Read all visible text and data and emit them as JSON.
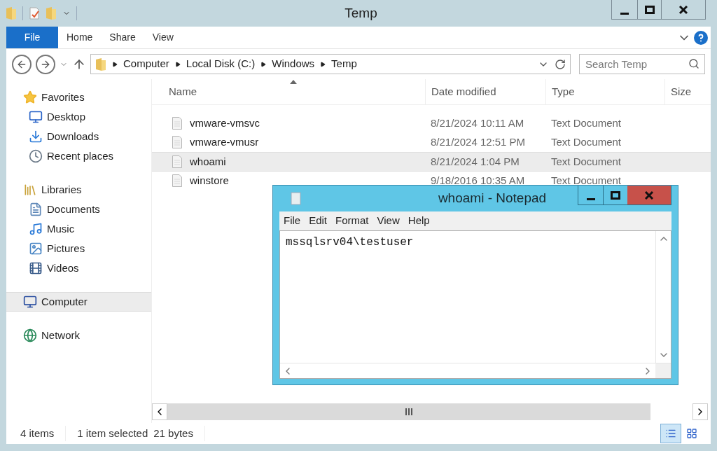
{
  "window": {
    "title": "Temp"
  },
  "ribbon": {
    "tabs": [
      {
        "label": "File",
        "selected": true
      },
      {
        "label": "Home",
        "selected": false
      },
      {
        "label": "Share",
        "selected": false
      },
      {
        "label": "View",
        "selected": false
      }
    ]
  },
  "address_bar": {
    "path": [
      "Computer",
      "Local Disk (C:)",
      "Windows",
      "Temp"
    ]
  },
  "search": {
    "placeholder": "Search Temp"
  },
  "navigation": {
    "groups": [
      {
        "label": "Favorites",
        "selected": false,
        "children": [
          {
            "label": "Desktop",
            "selected": false
          },
          {
            "label": "Downloads",
            "selected": false
          },
          {
            "label": "Recent places",
            "selected": false
          }
        ]
      },
      {
        "label": "Libraries",
        "selected": false,
        "children": [
          {
            "label": "Documents",
            "selected": false
          },
          {
            "label": "Music",
            "selected": false
          },
          {
            "label": "Pictures",
            "selected": false
          },
          {
            "label": "Videos",
            "selected": false
          }
        ]
      },
      {
        "label": "Computer",
        "selected": true
      },
      {
        "label": "Network",
        "selected": false
      }
    ]
  },
  "file_list": {
    "columns": [
      "Name",
      "Date modified",
      "Type",
      "Size"
    ],
    "rows": [
      {
        "name": "vmware-vmsvc",
        "date_modified": "8/21/2024 10:11 AM",
        "type": "Text Document",
        "selected": false
      },
      {
        "name": "vmware-vmusr",
        "date_modified": "8/21/2024 12:51 PM",
        "type": "Text Document",
        "selected": false
      },
      {
        "name": "whoami",
        "date_modified": "8/21/2024 1:04 PM",
        "type": "Text Document",
        "selected": true
      },
      {
        "name": "winstore",
        "date_modified": "9/18/2016 10:35 AM",
        "type": "Text Document",
        "selected": false
      }
    ]
  },
  "status_bar": {
    "item_count": "4 items",
    "selection": "1 item selected",
    "size": "21 bytes"
  },
  "notepad": {
    "title": "whoami - Notepad",
    "menu": [
      "File",
      "Edit",
      "Format",
      "View",
      "Help"
    ],
    "content": "mssqlsrv04\\testuser"
  }
}
